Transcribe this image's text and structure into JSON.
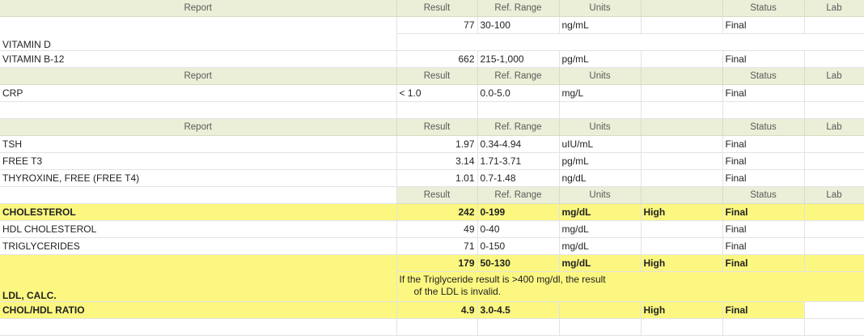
{
  "headers": {
    "report": "Report",
    "result": "Result",
    "ref_range": "Ref. Range",
    "units": "Units",
    "status": "Status",
    "lab": "Lab"
  },
  "rows": {
    "vitd": {
      "report": "VITAMIN D",
      "result": "77",
      "ref": "30-100",
      "units": "ng/mL",
      "flag": "",
      "status": "Final"
    },
    "b12": {
      "report": "VITAMIN B-12",
      "result": "662",
      "ref": "215-1,000",
      "units": "pg/mL",
      "flag": "",
      "status": "Final"
    },
    "crp": {
      "report": "CRP",
      "result": "< 1.0",
      "ref": "0.0-5.0",
      "units": "mg/L",
      "flag": "",
      "status": "Final"
    },
    "tsh": {
      "report": "TSH",
      "result": "1.97",
      "ref": "0.34-4.94",
      "units": "uIU/mL",
      "flag": "",
      "status": "Final"
    },
    "ft3": {
      "report": "FREE T3",
      "result": "3.14",
      "ref": "1.71-3.71",
      "units": "pg/mL",
      "flag": "",
      "status": "Final"
    },
    "ft4": {
      "report": "THYROXINE, FREE (FREE T4)",
      "result": "1.01",
      "ref": "0.7-1.48",
      "units": "ng/dL",
      "flag": "",
      "status": "Final"
    },
    "chol": {
      "report": "CHOLESTEROL",
      "result": "242",
      "ref": "0-199",
      "units": "mg/dL",
      "flag": "High",
      "status": "Final"
    },
    "hdl": {
      "report": "HDL CHOLESTEROL",
      "result": "49",
      "ref": "0-40",
      "units": "mg/dL",
      "flag": "",
      "status": "Final"
    },
    "trig": {
      "report": "TRIGLYCERIDES",
      "result": "71",
      "ref": "0-150",
      "units": "mg/dL",
      "flag": "",
      "status": "Final"
    },
    "ldl": {
      "report": "LDL, CALC.",
      "result": "179",
      "ref": "50-130",
      "units": "mg/dL",
      "flag": "High",
      "status": "Final",
      "note_line1": "If the Triglyceride result is >400 mg/dl, the result",
      "note_line2": "of the LDL is invalid."
    },
    "ratio": {
      "report": "CHOL/HDL RATIO",
      "result": "4.9",
      "ref": "3.0-4.5",
      "units": "",
      "flag": "High",
      "status": "Final"
    }
  },
  "colors": {
    "header_bg": "#ebefd8",
    "highlight_bg": "#fbf781",
    "grid_line": "#e3e3e3"
  }
}
